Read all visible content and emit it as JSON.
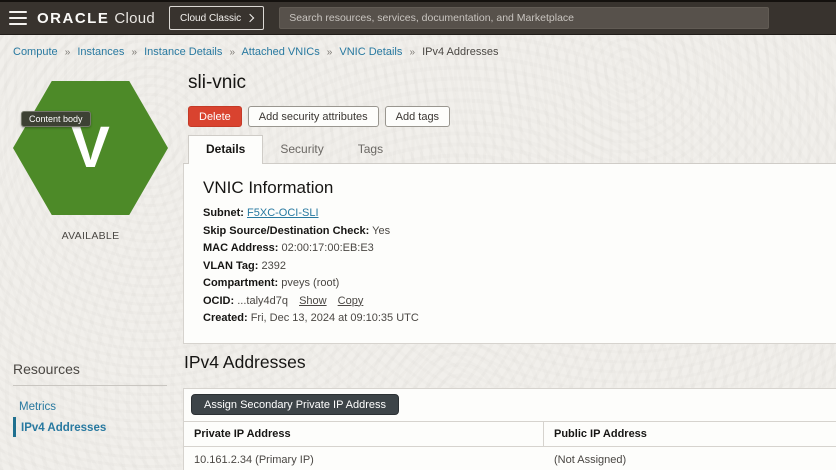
{
  "header": {
    "logo": {
      "oracle": "ORACLE",
      "cloud": "Cloud"
    },
    "cloud_classic_label": "Cloud Classic",
    "search_placeholder": "Search resources, services, documentation, and Marketplace"
  },
  "breadcrumb": {
    "separator": "»",
    "links": [
      "Compute",
      "Instances",
      "Instance Details",
      "Attached VNICs",
      "VNIC Details"
    ],
    "current": "IPv4 Addresses"
  },
  "status_card": {
    "tooltip": "Content body",
    "letter": "V",
    "status": "AVAILABLE"
  },
  "page": {
    "title": "sli-vnic",
    "delete_label": "Delete",
    "add_security_label": "Add security attributes",
    "add_tags_label": "Add tags",
    "tabs": [
      "Details",
      "Security",
      "Tags"
    ]
  },
  "vnic_info": {
    "heading": "VNIC Information",
    "rows": [
      {
        "label": "Subnet:",
        "value": "F5XC-OCI-SLI"
      },
      {
        "label": "Skip Source/Destination Check:",
        "value": "Yes"
      },
      {
        "label": "MAC Address:",
        "value": "02:00:17:00:EB:E3"
      },
      {
        "label": "VLAN Tag:",
        "value": "2392"
      },
      {
        "label": "Compartment:",
        "value": "pveys (root)"
      },
      {
        "label": "OCID:",
        "value": "...taly4d7q",
        "show_label": "Show",
        "copy_label": "Copy"
      },
      {
        "label": "Created:",
        "value": "Fri, Dec 13, 2024 at 09:10:35 UTC"
      }
    ]
  },
  "resources": {
    "heading": "Resources",
    "items": [
      {
        "label": "Metrics",
        "active": false
      },
      {
        "label": "IPv4 Addresses",
        "active": true
      }
    ]
  },
  "ipv4_section": {
    "heading": "IPv4 Addresses",
    "assign_button_label": "Assign Secondary Private IP Address",
    "table": {
      "columns": [
        "Private IP Address",
        "Public IP Address"
      ],
      "rows": [
        [
          "10.161.2.34 (Primary IP)",
          "(Not Assigned)"
        ]
      ]
    }
  },
  "colors": {
    "header_bg": "#38332e",
    "page_bg": "#f1efeb",
    "panel_bg": "#fdfdfb",
    "accent_link": "#2879a0",
    "delete_red": "#d9432f",
    "hexagon_green": "#4d8a28",
    "dark_button": "#3d4448",
    "selected_bar": "#20708f"
  }
}
